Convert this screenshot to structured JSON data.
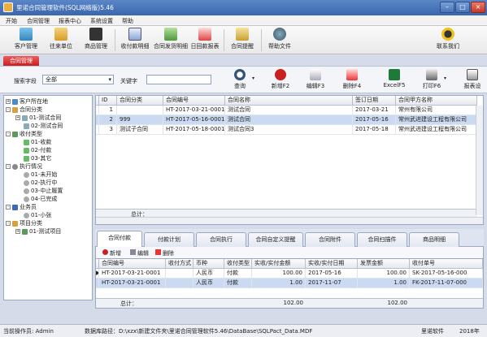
{
  "window": {
    "title": "里诺合同管理软件(SQL网络版)5.46",
    "btn_min": "–",
    "btn_max": "□",
    "btn_close": "×"
  },
  "menu": [
    "开始",
    "合同管理",
    "报表中心",
    "系统设置",
    "帮助"
  ],
  "toolbar": {
    "items": [
      "客户管理",
      "往来单位",
      "商品管理",
      "收付款明细",
      "合同发货明细",
      "日回款报表",
      "合同提醒",
      "帮助文件"
    ],
    "contact": "联系我们"
  },
  "doc_tab": "合同管理",
  "search": {
    "field_label": "搜索字段",
    "field_value": "全部",
    "keyword_label": "关键字",
    "keyword_value": ""
  },
  "actions": [
    "查询",
    "新增F2",
    "编辑F3",
    "删除F4",
    "ExcelF5",
    "打印F6",
    "报表设"
  ],
  "tree": [
    {
      "label": "客户所在地",
      "toggle": "+"
    },
    {
      "label": "合同分类",
      "toggle": "-"
    },
    {
      "label": "01-测试合同",
      "toggle": "+"
    },
    {
      "label": "02-测试合同",
      "toggle": ""
    },
    {
      "label": "收付类型",
      "toggle": "-"
    },
    {
      "label": "01-收款",
      "toggle": ""
    },
    {
      "label": "02-付款",
      "toggle": ""
    },
    {
      "label": "03-其它",
      "toggle": ""
    },
    {
      "label": "执行情况",
      "toggle": "-"
    },
    {
      "label": "01-未开始",
      "toggle": ""
    },
    {
      "label": "02-执行中",
      "toggle": ""
    },
    {
      "label": "03-中止履置",
      "toggle": ""
    },
    {
      "label": "04-已完成",
      "toggle": ""
    },
    {
      "label": "业务员",
      "toggle": "-"
    },
    {
      "label": "01-小张",
      "toggle": ""
    },
    {
      "label": "项目分类",
      "toggle": "-"
    },
    {
      "label": "01-测试项目",
      "toggle": "+"
    }
  ],
  "grid": {
    "headers": [
      "ID",
      "合同分类",
      "合同编号",
      "合同名称",
      "签订日期",
      "合同甲方名称"
    ],
    "rows": [
      {
        "marker": "",
        "id": "1",
        "category": "",
        "code": "HT-2017-03-21-0001",
        "name": "测试合同",
        "date": "2017-03-21",
        "party": "常州有限公司"
      },
      {
        "marker": "",
        "id": "2",
        "category": "999",
        "code": "HT-2017-05-16-0001",
        "name": "测试合同",
        "date": "2017-05-16",
        "party": "常州武进建设工程有限公司"
      },
      {
        "marker": "",
        "id": "3",
        "category": "测试子合同",
        "code": "HT-2017-05-18-0001",
        "name": "测试合同3",
        "date": "2017-05-18",
        "party": "常州武进建设工程有限公司"
      }
    ],
    "footer_label": "总计："
  },
  "bottom_tabs": [
    "合同付款",
    "付款计划",
    "合同执行",
    "合同自定义提醒",
    "合同附件",
    "合同扫描件",
    "商品明细"
  ],
  "sub_toolbar": [
    "新增",
    "编辑",
    "删除"
  ],
  "subgrid": {
    "headers": [
      "合同编号",
      "收付方式",
      "币种",
      "收付类型",
      "实收/实付金额",
      "实收/实付日期",
      "发票金额",
      "收付单号"
    ],
    "rows": [
      {
        "marker": "▶",
        "code": "HT-2017-03-21-0001",
        "method": "",
        "currency": "人民币",
        "type": "付款",
        "amount": "100.00",
        "date": "2017-05-16",
        "invoice": "100.00",
        "no": "SK-2017-05-16-000"
      },
      {
        "marker": "",
        "code": "HT-2017-03-21-0001",
        "method": "",
        "currency": "人民币",
        "type": "付款",
        "amount": "1.00",
        "date": "2017-11-07",
        "invoice": "1.00",
        "no": "FK-2017-11-07-000"
      }
    ],
    "footer_label": "总计：",
    "footer_amount": "102.00",
    "footer_invoice": "102.00"
  },
  "status": {
    "operator": "当前操作员: Admin",
    "db": "数据库路径：D:\\xzx\\新建文件夹\\里诺合同管理软件5.46\\DataBase\\SQLPact_Data.MDF",
    "brand": "里诺软件",
    "year": "2018年"
  },
  "colors": {
    "accent": "#c92020",
    "selection": "#c9daf2",
    "titlebar": "#3a67ad"
  }
}
